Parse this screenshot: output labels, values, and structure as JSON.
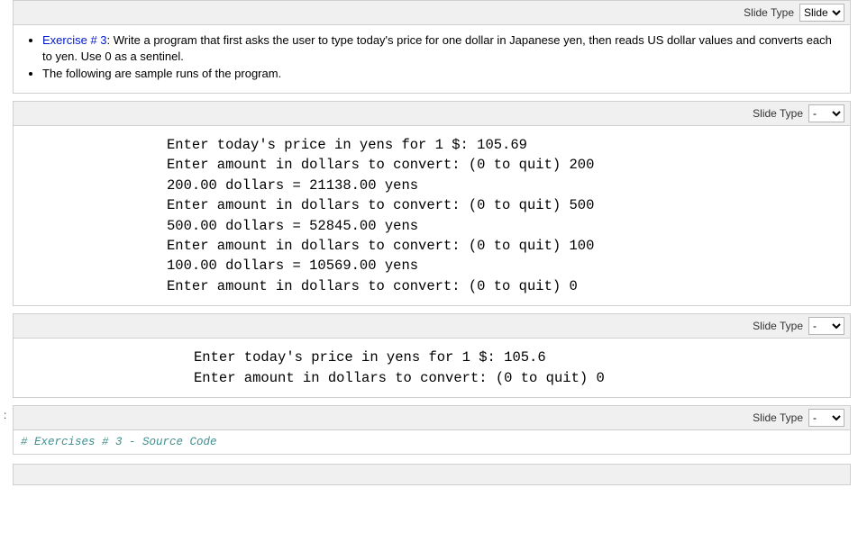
{
  "cells": [
    {
      "slideTypeLabel": "Slide Type",
      "slideTypeValue": "Slide",
      "exerciseLabel": "Exercise # 3",
      "exerciseText": ": Write a program that first asks the user to type today's price for one dollar in Japanese yen, then reads US dollar values and converts each to yen. Use 0 as a sentinel.",
      "secondBullet": "The following are sample runs of the program."
    },
    {
      "slideTypeLabel": "Slide Type",
      "slideTypeValue": "-",
      "output": "Enter today's price in yens for 1 $: 105.69\nEnter amount in dollars to convert: (0 to quit) 200\n200.00 dollars = 21138.00 yens\nEnter amount in dollars to convert: (0 to quit) 500\n500.00 dollars = 52845.00 yens\nEnter amount in dollars to convert: (0 to quit) 100\n100.00 dollars = 10569.00 yens\nEnter amount in dollars to convert: (0 to quit) 0"
    },
    {
      "slideTypeLabel": "Slide Type",
      "slideTypeValue": "-",
      "output": "Enter today's price in yens for 1 $: 105.6\nEnter amount in dollars to convert: (0 to quit) 0"
    },
    {
      "slideTypeLabel": "Slide Type",
      "slideTypeValue": "-",
      "codeComment": "# Exercises # 3 - Source Code"
    }
  ],
  "selectOptions": {
    "wide": [
      "Slide"
    ],
    "narrow": [
      "-"
    ]
  }
}
